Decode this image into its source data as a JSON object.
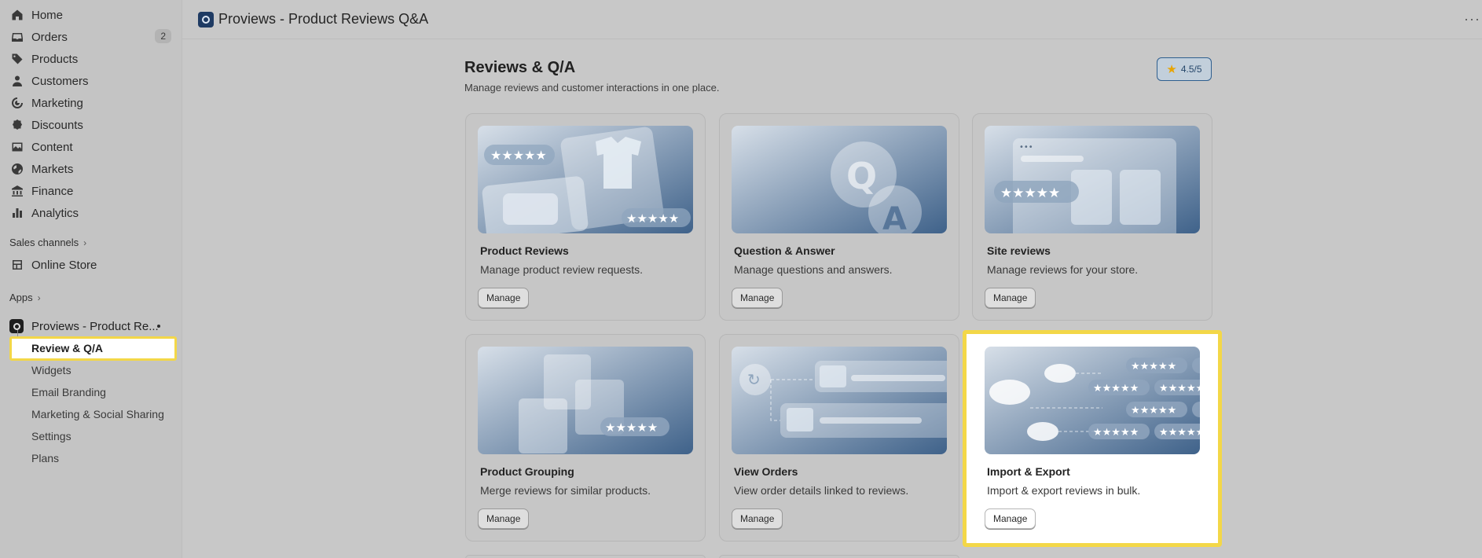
{
  "sidebar": {
    "items": [
      {
        "label": "Home",
        "icon": "home-icon"
      },
      {
        "label": "Orders",
        "icon": "inbox-icon",
        "badge": "2"
      },
      {
        "label": "Products",
        "icon": "tag-icon"
      },
      {
        "label": "Customers",
        "icon": "person-icon"
      },
      {
        "label": "Marketing",
        "icon": "target-icon"
      },
      {
        "label": "Discounts",
        "icon": "discount-icon"
      },
      {
        "label": "Content",
        "icon": "image-icon"
      },
      {
        "label": "Markets",
        "icon": "globe-icon"
      },
      {
        "label": "Finance",
        "icon": "bank-icon"
      },
      {
        "label": "Analytics",
        "icon": "bar-chart-icon"
      }
    ],
    "sales_channels_label": "Sales channels",
    "online_store_label": "Online Store",
    "apps_label": "Apps",
    "app_name": "Proviews - Product Re...",
    "app_subitems": [
      "Review & Q/A",
      "Widgets",
      "Email Branding",
      "Marketing & Social Sharing",
      "Settings",
      "Plans"
    ]
  },
  "topbar": {
    "title": "Proviews - Product Reviews Q&A",
    "more": "···"
  },
  "main": {
    "title": "Reviews & Q/A",
    "subtitle": "Manage reviews and customer interactions in one place.",
    "rating": "4.5/5",
    "manage_label": "Manage",
    "cards": [
      {
        "title": "Product Reviews",
        "desc": "Manage product review requests."
      },
      {
        "title": "Question & Answer",
        "desc": "Manage questions and answers."
      },
      {
        "title": "Site reviews",
        "desc": "Manage reviews for your store."
      },
      {
        "title": "Product Grouping",
        "desc": "Merge reviews for similar products."
      },
      {
        "title": "View Orders",
        "desc": "View order details linked to reviews."
      },
      {
        "title": "Import & Export",
        "desc": "Import & export reviews in bulk."
      }
    ]
  },
  "colors": {
    "highlight": "#f3d748",
    "star": "#e8a400",
    "thumb_dark": "#3c5f86",
    "thumb_light": "#d4dde6"
  }
}
